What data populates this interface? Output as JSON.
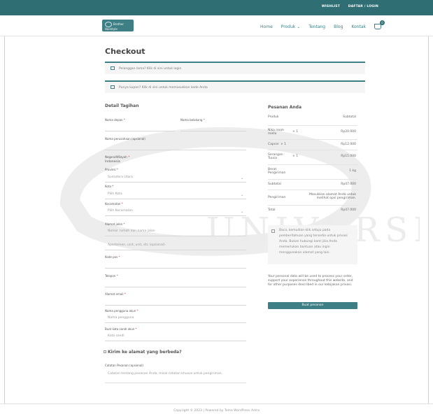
{
  "topbar": {
    "daftar": "WISHLIST",
    "login": "DAFTAR / LOGIN"
  },
  "header": {
    "logo_text": "Brother Hairstyle",
    "nav": [
      "Home",
      "Produk",
      "Tentang",
      "Blog",
      "Kontak"
    ],
    "cart_count": "0"
  },
  "page": {
    "title": "Checkout"
  },
  "notices": {
    "login": "Pelanggan lama? Klik di sini untuk login",
    "coupon": "Punya kupon? Klik di sini untuk memasukkan kode Anda"
  },
  "billing": {
    "heading": "Detail Tagihan",
    "first_name_label": "Nama depan",
    "last_name_label": "Nama belakang",
    "company_label": "Nama perusahaan (opsional)",
    "country_label": "Negara/Wilayah",
    "country_value": "Indonesia",
    "province_label": "Provinsi",
    "province_value": "Sumatera Utara",
    "city_label": "Kota",
    "city_value": "Pilih Kota",
    "district_label": "Kecamatan",
    "district_value": "Pilih Kecamatan",
    "address_label": "Alamat jalan",
    "address_placeholder": "Nomor rumah dan nama jalan",
    "address2_placeholder": "Apartemen, unit, unit, etc (opsional)",
    "postcode_label": "Kode pos",
    "phone_label": "Telepon",
    "email_label": "Alamat email",
    "username_label": "Nama pengguna akun",
    "username_placeholder": "Nama pengguna",
    "password_label": "Buat kata sandi akun",
    "password_placeholder": "Kata sandi"
  },
  "shipping": {
    "heading": "Kirim ke alamat yang berbeda?",
    "notes_label": "Catatan Pesanan (opsional)",
    "notes_placeholder": "Catatan tentang pesanan Anda, misal catatan khusus untuk pengiriman."
  },
  "order": {
    "heading": "Pesanan Anda",
    "col_product": "Produk",
    "col_subtotal": "Subtotal",
    "items": [
      {
        "name": "Nika room mello",
        "qty": "× 1",
        "subtotal": "Rp20.000"
      },
      {
        "name": "Capcer",
        "qty": "× 1",
        "subtotal": "Rp12.000"
      },
      {
        "name": "Serangan Tuuco",
        "qty": "× 1",
        "subtotal": "Rp15.000"
      }
    ],
    "weight_label": "Berat Pengiriman",
    "weight_value": "1 kg",
    "subtotal_label": "Subtotal",
    "subtotal_value": "Rp47.000",
    "shipping_label": "Pengiriman",
    "shipping_value": "Masukkan alamat Anda untuk melihat opsi pengiriman.",
    "total_label": "Total",
    "total_value": "Rp47.000",
    "privacy_checkbox_text": "Baca, kemudian klik setuju pada pemberitahuan yang tersedia untuk privasi Anda. Bukan hubungi kami jika Anda memerlukan bantuan atau ingin menggunakan alamat yang lain.",
    "privacy_text": "Your personal data will be used to process your order, support your experience throughout this website, and for other purposes described in our kebijakan privasi.",
    "place_order": "Buat pesanan"
  },
  "footer": {
    "text": "Copyright © 2023 | Powered by Tema WordPress Astra"
  },
  "watermark": {
    "text": "UNIVERSITY"
  }
}
